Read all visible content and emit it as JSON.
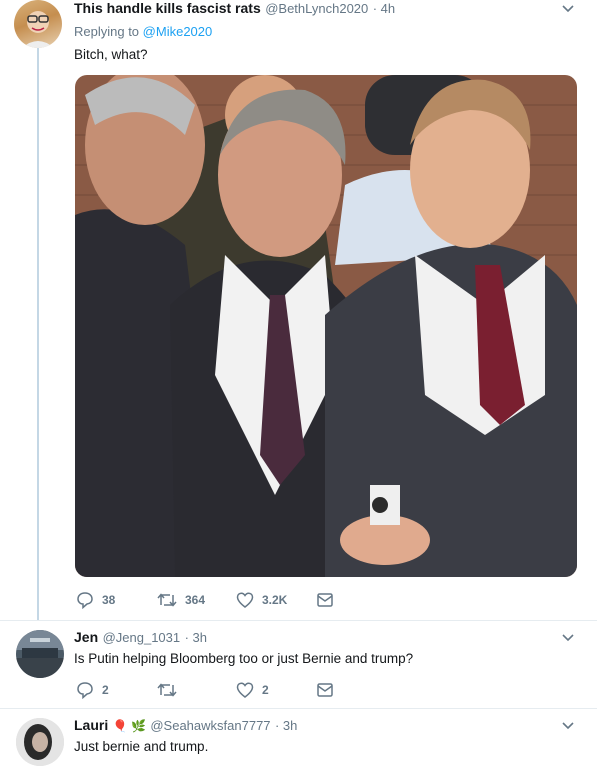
{
  "tweet1": {
    "display_name": "This handle kills fascist rats",
    "handle": "@BethLynch2020",
    "time": "· 4h",
    "replying_prefix": "Replying to",
    "replying_to": "@Mike2020",
    "text": "Bitch, what?",
    "actions": {
      "replies": "38",
      "retweets": "364",
      "likes": "3.2K"
    }
  },
  "tweet2": {
    "display_name": "Jen",
    "handle": "@Jeng_1031",
    "time": "· 3h",
    "text": "Is Putin helping Bloomberg too or just Bernie and trump?",
    "actions": {
      "replies": "2",
      "retweets": "",
      "likes": "2"
    }
  },
  "tweet3": {
    "display_name": "Lauri",
    "name_emoji": "🎈 🌿",
    "handle": "@Seahawksfan7777",
    "time": "· 3h",
    "text": "Just bernie and trump."
  },
  "colors": {
    "accent": "#1da1f2",
    "muted": "#657786",
    "thread_line": "#c4d7e5"
  },
  "icons": [
    "reply-icon",
    "retweet-icon",
    "like-icon",
    "message-icon",
    "chevron-down-icon"
  ]
}
